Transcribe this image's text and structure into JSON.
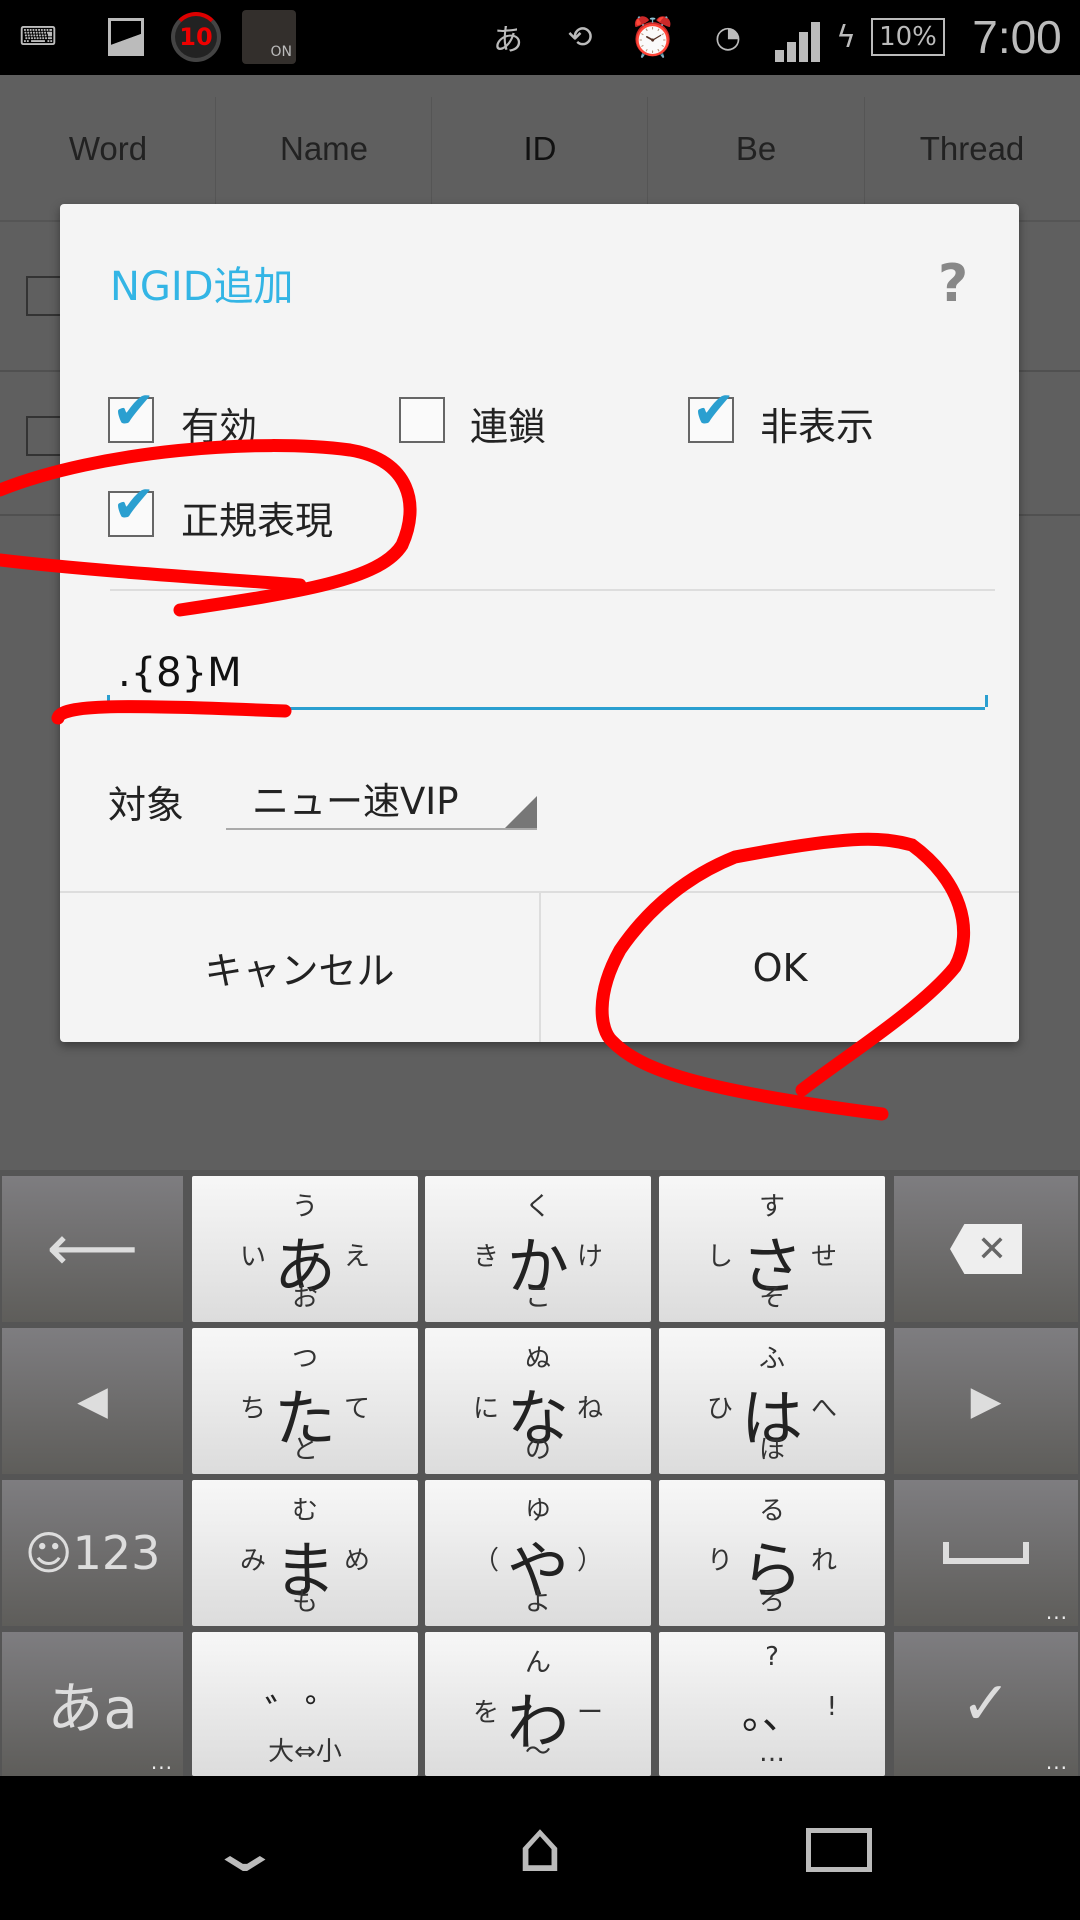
{
  "status_bar": {
    "notification_count": "10",
    "nfc_badge": "ON",
    "ime_indicator": "あ",
    "battery": "10%",
    "time": "7:00",
    "icons": [
      "keyboard-icon",
      "image-icon",
      "counter-icon",
      "nfc-icon",
      "ime-icon",
      "rotation-icon",
      "alarm-icon",
      "wifi-icon",
      "signal-icon",
      "charging-icon",
      "battery-icon"
    ]
  },
  "tabs": [
    {
      "label": "Word"
    },
    {
      "label": "Name"
    },
    {
      "label": "ID",
      "selected": true
    },
    {
      "label": "Be"
    },
    {
      "label": "Thread"
    }
  ],
  "dialog": {
    "title": "NGID追加",
    "help": "?",
    "accent": "#33b5e5",
    "checkboxes": [
      {
        "label": "有効",
        "checked": true
      },
      {
        "label": "連鎖",
        "checked": false
      },
      {
        "label": "非表示",
        "checked": true
      },
      {
        "label": "正規表現",
        "checked": true
      }
    ],
    "input_value": ".{8}M",
    "target_label": "対象",
    "target_value": "ニュー速VIP",
    "cancel_label": "キャンセル",
    "ok_label": "OK"
  },
  "keyboard": {
    "keys": [
      {
        "main": "あ",
        "up": "う",
        "left": "い",
        "right": "え",
        "down": "お"
      },
      {
        "main": "か",
        "up": "く",
        "left": "き",
        "right": "け",
        "down": "こ"
      },
      {
        "main": "さ",
        "up": "す",
        "left": "し",
        "right": "せ",
        "down": "そ"
      },
      {
        "main": "た",
        "up": "つ",
        "left": "ち",
        "right": "て",
        "down": "と"
      },
      {
        "main": "な",
        "up": "ぬ",
        "left": "に",
        "right": "ね",
        "down": "の"
      },
      {
        "main": "は",
        "up": "ふ",
        "left": "ひ",
        "right": "へ",
        "down": "ほ"
      },
      {
        "main": "ま",
        "up": "む",
        "left": "み",
        "right": "め",
        "down": "も"
      },
      {
        "main": "や",
        "up": "ゆ",
        "left": "（",
        "right": "）",
        "down": "よ"
      },
      {
        "main": "ら",
        "up": "る",
        "left": "り",
        "right": "れ",
        "down": "ろ"
      },
      {
        "main": "゛゜",
        "up": "",
        "left": "",
        "right": "",
        "down": "大⇔小"
      },
      {
        "main": "わ",
        "up": "ん",
        "left": "を",
        "right": "ー",
        "down": "～"
      },
      {
        "main": "。、",
        "up": "?",
        "left": "",
        "right": "!",
        "down": "…"
      }
    ],
    "emoji_num": "☺123",
    "mode": "あa",
    "more": "..."
  },
  "annotation_color": "#ff0000"
}
